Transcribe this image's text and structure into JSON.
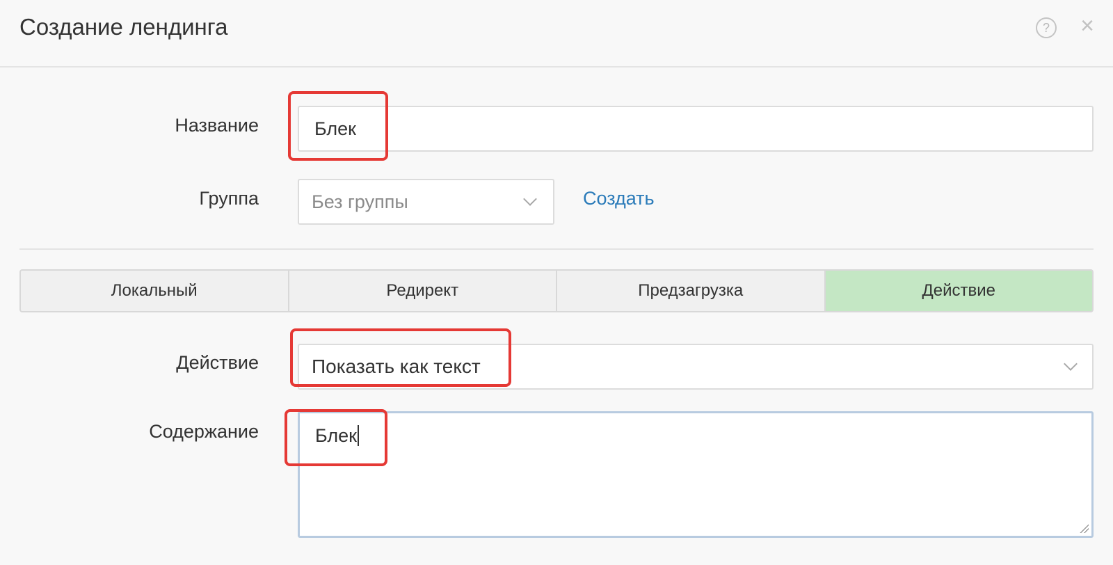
{
  "dialog": {
    "title": "Создание лендинга",
    "help_icon": "question-circle-icon",
    "close_icon": "close-x-icon",
    "close_glyph": "×",
    "help_glyph": "?"
  },
  "form": {
    "name": {
      "label": "Название",
      "value": "Блек"
    },
    "group": {
      "label": "Группа",
      "selected": "Без группы",
      "create_link": "Создать"
    },
    "tabs": [
      {
        "label": "Локальный",
        "active": false
      },
      {
        "label": "Редирект",
        "active": false
      },
      {
        "label": "Предзагрузка",
        "active": false
      },
      {
        "label": "Действие",
        "active": true
      }
    ],
    "action": {
      "label": "Действие",
      "selected": "Показать как текст"
    },
    "content": {
      "label": "Содержание",
      "value": "Блек"
    }
  },
  "colors": {
    "active_tab": "#c4e7c4",
    "link": "#2b7bb9",
    "highlight": "#e53935"
  }
}
